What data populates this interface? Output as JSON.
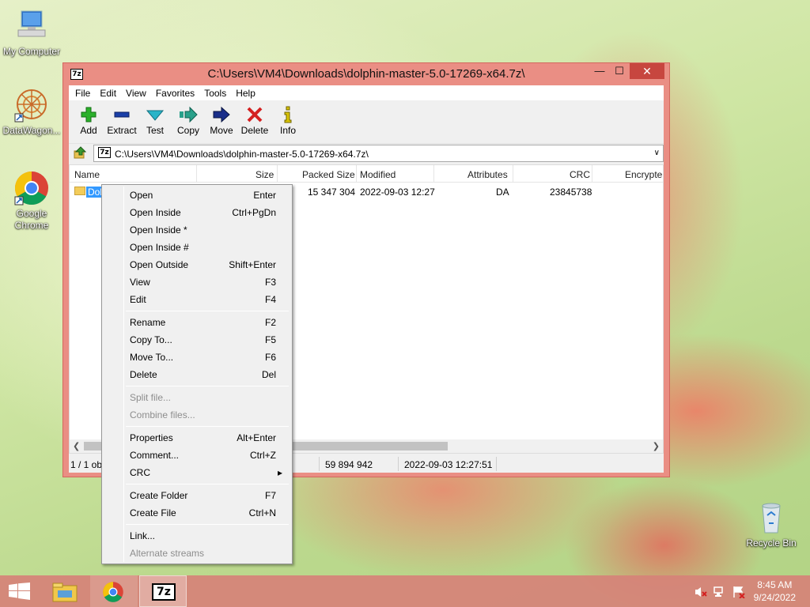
{
  "desktop": {
    "icons": [
      {
        "label": "My Computer"
      },
      {
        "label": "DataWagon..."
      },
      {
        "label": "Google Chrome"
      },
      {
        "label": "Recycle Bin"
      }
    ]
  },
  "window": {
    "app_icon": "7z",
    "title": "C:\\Users\\VM4\\Downloads\\dolphin-master-5.0-17269-x64.7z\\",
    "controls": {
      "minimize": "—",
      "maximize": "☐",
      "close": "✕"
    }
  },
  "menubar": [
    "File",
    "Edit",
    "View",
    "Favorites",
    "Tools",
    "Help"
  ],
  "toolbar": [
    {
      "label": "Add",
      "icon": "plus-icon",
      "color": "#2bb02b"
    },
    {
      "label": "Extract",
      "icon": "minus-icon",
      "color": "#1a3fa8"
    },
    {
      "label": "Test",
      "icon": "check-icon",
      "color": "#2ab4c8"
    },
    {
      "label": "Copy",
      "icon": "double-arrow-icon",
      "color": "#2aa08a"
    },
    {
      "label": "Move",
      "icon": "arrow-right-icon",
      "color": "#1a2e8a"
    },
    {
      "label": "Delete",
      "icon": "x-icon",
      "color": "#d42020"
    },
    {
      "label": "Info",
      "icon": "info-icon",
      "color": "#d9c400"
    }
  ],
  "address": {
    "icon": "7z",
    "path": "C:\\Users\\VM4\\Downloads\\dolphin-master-5.0-17269-x64.7z\\"
  },
  "columns": [
    "Name",
    "Size",
    "Packed Size",
    "Modified",
    "Attributes",
    "CRC",
    "Encrypte"
  ],
  "rows": [
    {
      "name": "Dol",
      "size": "",
      "packed": "15 347 304",
      "modified": "2022-09-03 12:27",
      "attributes": "DA",
      "crc": "23845738"
    }
  ],
  "status": {
    "selection": "1 / 1 ob",
    "total_size": "59 894 942",
    "modified": "2022-09-03 12:27:51"
  },
  "context_menu": [
    {
      "label": "Open",
      "shortcut": "Enter"
    },
    {
      "label": "Open Inside",
      "shortcut": "Ctrl+PgDn"
    },
    {
      "label": "Open Inside *",
      "shortcut": ""
    },
    {
      "label": "Open Inside #",
      "shortcut": ""
    },
    {
      "label": "Open Outside",
      "shortcut": "Shift+Enter"
    },
    {
      "label": "View",
      "shortcut": "F3"
    },
    {
      "label": "Edit",
      "shortcut": "F4"
    },
    {
      "label": "Rename",
      "shortcut": "F2"
    },
    {
      "label": "Copy To...",
      "shortcut": "F5"
    },
    {
      "label": "Move To...",
      "shortcut": "F6"
    },
    {
      "label": "Delete",
      "shortcut": "Del"
    },
    {
      "label": "Split file...",
      "shortcut": ""
    },
    {
      "label": "Combine files...",
      "shortcut": ""
    },
    {
      "label": "Properties",
      "shortcut": "Alt+Enter"
    },
    {
      "label": "Comment...",
      "shortcut": "Ctrl+Z"
    },
    {
      "label": "CRC",
      "shortcut": "▸"
    },
    {
      "label": "Create Folder",
      "shortcut": "F7"
    },
    {
      "label": "Create File",
      "shortcut": "Ctrl+N"
    },
    {
      "label": "Link...",
      "shortcut": ""
    },
    {
      "label": "Alternate streams",
      "shortcut": ""
    }
  ],
  "taskbar": {
    "pinned": [
      "file-explorer-icon",
      "chrome-icon",
      "7zip-icon"
    ],
    "active_app_label": "7z",
    "clock_time": "8:45 AM",
    "clock_date": "9/24/2022"
  },
  "colors": {
    "window_frame": "#ea8e84",
    "selection": "#3399ff",
    "taskbar": "#d6827a"
  }
}
